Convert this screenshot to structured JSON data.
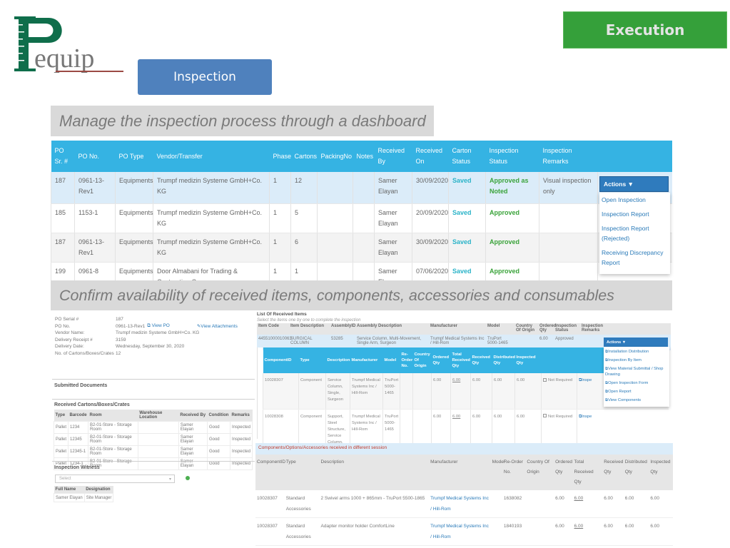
{
  "logo": {
    "text": "Pequip"
  },
  "buttons": {
    "inspection": "Inspection",
    "execution": "Execution"
  },
  "captions": {
    "dashboard": "Manage the inspection process through a dashboard",
    "confirm": "Confirm availability of received items, components, accessories and consumables"
  },
  "dashboard": {
    "columns": [
      "PO Sr. #",
      "PO No.",
      "PO Type",
      "Vendor/Transfer",
      "Phase",
      "Cartons",
      "PackingNo",
      "Notes",
      "Received By",
      "Received On",
      "Carton Status",
      "Inspection Status",
      "Inspection Remarks",
      ""
    ],
    "rows": [
      {
        "sr": "187",
        "po": "0961-13-Rev1",
        "type": "Equipments",
        "vendor": "Trumpf medizin Systeme GmbH+Co. KG",
        "phase": "1",
        "cartons": "12",
        "packing": "",
        "notes": "",
        "by": "Samer Elayan",
        "on": "30/09/2020",
        "carton_status": "Saved",
        "insp_status": "Approved as Noted",
        "remarks": "Visual inspection only"
      },
      {
        "sr": "185",
        "po": "1153-1",
        "type": "Equipments",
        "vendor": "Trumpf medizin Systeme GmbH+Co. KG",
        "phase": "1",
        "cartons": "5",
        "packing": "",
        "notes": "",
        "by": "Samer Elayan",
        "on": "20/09/2020",
        "carton_status": "Saved",
        "insp_status": "Approved",
        "remarks": ""
      },
      {
        "sr": "187",
        "po": "0961-13-Rev1",
        "type": "Equipments",
        "vendor": "Trumpf medizin Systeme GmbH+Co. KG",
        "phase": "1",
        "cartons": "6",
        "packing": "",
        "notes": "",
        "by": "Samer Elayan",
        "on": "30/09/2020",
        "carton_status": "Saved",
        "insp_status": "Approved",
        "remarks": ""
      },
      {
        "sr": "199",
        "po": "0961-8",
        "type": "Equipments",
        "vendor": "Door Almabani for Trading & Contracting Co.",
        "phase": "1",
        "cartons": "1",
        "packing": "",
        "notes": "",
        "by": "Samer Elayan",
        "on": "07/06/2020",
        "carton_status": "Saved",
        "insp_status": "Approved",
        "remarks": ""
      }
    ],
    "actions": {
      "label": "Actions ▼",
      "menu": [
        "Open Inspection",
        "Inspection Report",
        "Inspection Report (Rejected)",
        "Receiving Discrepancy Report"
      ]
    }
  },
  "po_info": {
    "fields": [
      {
        "label": "PO Serial #",
        "value": "187"
      },
      {
        "label": "PO No.",
        "value": "0961-13-Rev1"
      },
      {
        "label": "Vendor Name:",
        "value": "Trumpf medizin Systeme GmbH+Co. KG"
      },
      {
        "label": "Delivery Receipt #",
        "value": "3159"
      },
      {
        "label": "Delivery Date:",
        "value": "Wednesday, September 30, 2020"
      },
      {
        "label": "No. of Cartons/Boxes/Crates",
        "value": "12"
      }
    ],
    "view_po": "View PO",
    "view_attachments": "View Attachments",
    "submitted_documents": "Submitted Documents"
  },
  "cartons": {
    "title": "Received Cartons/Boxes/Crates",
    "columns": [
      "Type",
      "Barcode",
      "Room",
      "Warehouse Location",
      "Received By",
      "Condition",
      "Remarks"
    ],
    "rows": [
      [
        "Pallet",
        "1234",
        "B2-01-Store - Storage Room",
        "",
        "Samer Elayan",
        "Good",
        "Inspected"
      ],
      [
        "Pallet",
        "12345",
        "B2-01-Store - Storage Room",
        "",
        "Samer Elayan",
        "Good",
        "Inspected"
      ],
      [
        "Pallet",
        "12345-1",
        "B2-01-Store - Storage Room",
        "",
        "Samer Elayan",
        "Good",
        "Inspected"
      ],
      [
        "Pallet",
        "1234-1",
        "B2-01-Store - Storage Room",
        "",
        "Samer Elayan",
        "Good",
        "Inspected"
      ]
    ]
  },
  "witness": {
    "title": "Inspection Witness",
    "select_placeholder": "Select",
    "columns": [
      "Full Name",
      "Designation"
    ],
    "rows": [
      [
        "Samer Elayan",
        "Site Manager"
      ]
    ]
  },
  "received_items": {
    "title": "List Of Received Items",
    "subtitle": "Select the items one by one to complete the inspection",
    "columns": [
      "Item Code",
      "Item Description",
      "AssemblyID",
      "Assembly Description",
      "Manufacturer",
      "Model",
      "Country Of Origin",
      "Ordered Qty",
      "Inspection Status",
      "Inspection Remarks",
      ""
    ],
    "row": [
      "44551000010063",
      "SURGICAL COLUMN",
      "53285",
      "Service Column, Multi-Movement, Single Arm, Surgeon",
      "Trumpf Medical Systems Inc / Hill-Rom",
      "TruPort 5000-1465",
      "",
      "6.00",
      "Approved",
      ""
    ],
    "actions": {
      "label": "Actions ▼",
      "menu": [
        "Installation Distribution",
        "Inspection By Item",
        "View Material Submittal / Shop Drawing",
        "Open Inspection Form",
        "Open Report",
        "View Components"
      ]
    }
  },
  "components": {
    "columns": [
      "ComponentID",
      "Type",
      "Description",
      "Manufacturer",
      "Model",
      "Re-Order No.",
      "Country Of Origin",
      "Ordered Qty",
      "Total Received Qty",
      "Received Qty",
      "Distributed Qty",
      "Inspected Qty",
      "",
      ""
    ],
    "rows": [
      [
        "10028307",
        "Component",
        "Service Column, Single, Surgeon",
        "Trumpf Medical Systems Inc / Hill-Rom",
        "TruPort 5000-1465",
        "",
        "",
        "6.00",
        "6.00",
        "6.00",
        "6.00",
        "6.00",
        "Not Required",
        "Inspe"
      ],
      [
        "10028308",
        "Component",
        "Support, Steel Structure, Service Column, Single, Surgeon",
        "Trumpf Medical Systems Inc / Hill-Rom",
        "TruPort 5000-1465",
        "",
        "",
        "6.00",
        "6.00",
        "6.00",
        "6.00",
        "6.00",
        "Not Required",
        "Inspe"
      ]
    ]
  },
  "different_session": {
    "title": "Components/Options/Accessories received in different session",
    "columns": [
      "ComponentID",
      "Type",
      "Description",
      "Manufacturer",
      "Model",
      "Re-Order No.",
      "Country Of Origin",
      "Ordered Qty",
      "Total Received Qty",
      "Received Qty",
      "Distributed Qty",
      "Inspected Qty"
    ],
    "rows": [
      [
        "10028307",
        "Standard Accessories",
        "2 Swivel arms 1000 + 865mm - TruPort 5500-1865",
        "Trumpf Medical Systems Inc / Hill-Rom",
        "",
        "1638082",
        "",
        "6.00",
        "6.00",
        "6.00",
        "6.00",
        "6.00"
      ],
      [
        "10028307",
        "Standard Accessories",
        "Adapter monitor holder ComfortLine",
        "Trumpf Medical Systems Inc / Hill-Rom",
        "",
        "1840193",
        "",
        "6.00",
        "6.00",
        "6.00",
        "6.00",
        "6.00"
      ]
    ]
  },
  "colors": {
    "header_blue": "#35b3e3",
    "inspection_button": "#4f81bd",
    "execution_button": "#35a03a",
    "saved": "#2ab3c8",
    "approved": "#3aa33a",
    "logo_green": "#0f6e4b",
    "logo_underline": "#9b4a44"
  }
}
